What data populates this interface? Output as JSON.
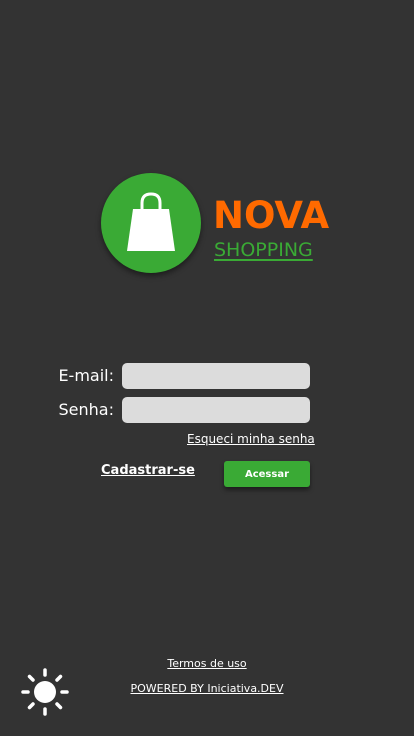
{
  "brand": {
    "name_top": "NOVA",
    "name_bottom": "SHOPPING"
  },
  "colors": {
    "background": "#333333",
    "brand_green": "#3aaa35",
    "brand_orange": "#ff6a00",
    "input_bg": "#dcdcdc"
  },
  "login_form": {
    "email_label": "E-mail:",
    "email_value": "",
    "password_label": "Senha:",
    "password_value": "",
    "forgot_password_link": "Esqueci minha senha",
    "register_link": "Cadastrar-se",
    "submit_button": "Acessar"
  },
  "footer": {
    "terms_link": "Termos de uso",
    "powered_by_link": "POWERED BY Iniciativa.DEV"
  },
  "icons": {
    "logo": "shopping-bag-icon",
    "theme_toggle": "sun-icon"
  }
}
